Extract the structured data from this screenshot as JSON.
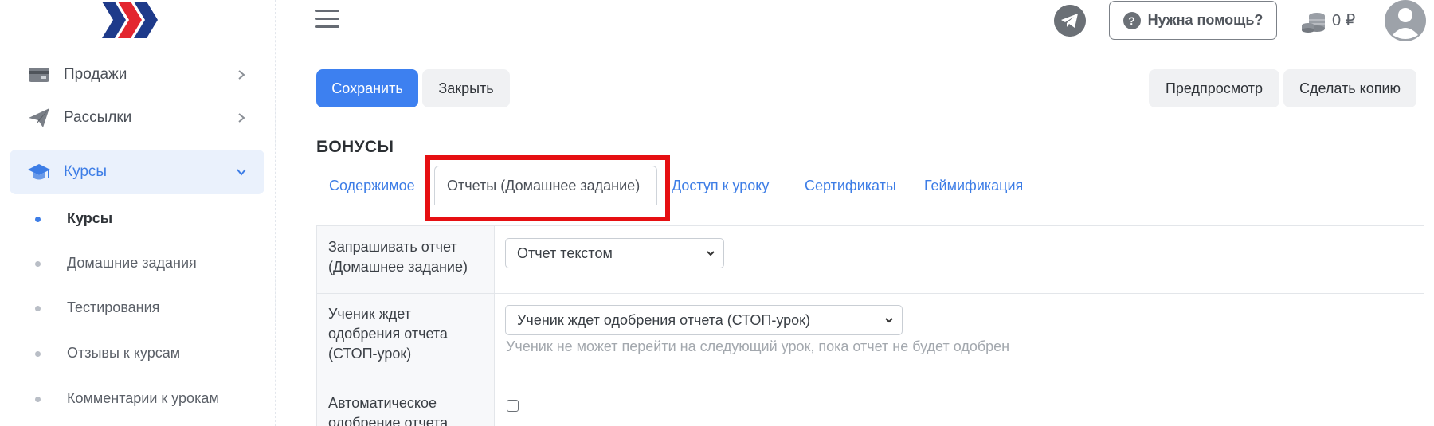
{
  "sidebar": {
    "items": [
      {
        "label": "Продажи",
        "icon": "card-icon"
      },
      {
        "label": "Рассылки",
        "icon": "paper-plane-icon"
      },
      {
        "label": "Курсы",
        "icon": "graduation-cap-icon"
      }
    ],
    "sub_items": [
      {
        "label": "Курсы"
      },
      {
        "label": "Домашние задания"
      },
      {
        "label": "Тестирования"
      },
      {
        "label": "Отзывы к курсам"
      },
      {
        "label": "Комментарии к урокам"
      }
    ]
  },
  "header": {
    "help_label": "Нужна помощь?",
    "balance": "0 ₽"
  },
  "toolbar": {
    "save_label": "Сохранить",
    "close_label": "Закрыть",
    "preview_label": "Предпросмотр",
    "copy_label": "Сделать копию"
  },
  "section": {
    "title": "БОНУСЫ"
  },
  "tabs": [
    {
      "label": "Содержимое"
    },
    {
      "label": "Отчеты (Домашнее задание)"
    },
    {
      "label": "Доступ к уроку"
    },
    {
      "label": "Сертификаты"
    },
    {
      "label": "Геймификация"
    }
  ],
  "form": {
    "rows": [
      {
        "label_lines": [
          "Запрашивать отчет",
          "(Домашнее задание)"
        ],
        "value": "Отчет текстом"
      },
      {
        "label_lines": [
          "Ученик ждет",
          "одобрения отчета",
          "(СТОП-урок)"
        ],
        "value": "Ученик ждет одобрения отчета (СТОП-урок)",
        "hint": "Ученик не может перейти на следующий урок, пока отчет не будет одобрен"
      },
      {
        "label_lines": [
          "Автоматическое",
          "одобрение отчета"
        ],
        "checked": false
      }
    ]
  },
  "colors": {
    "accent": "#3d80f0",
    "highlight": "#e60f12",
    "brand_navy": "#1e3a8a",
    "brand_red": "#e3262f"
  }
}
